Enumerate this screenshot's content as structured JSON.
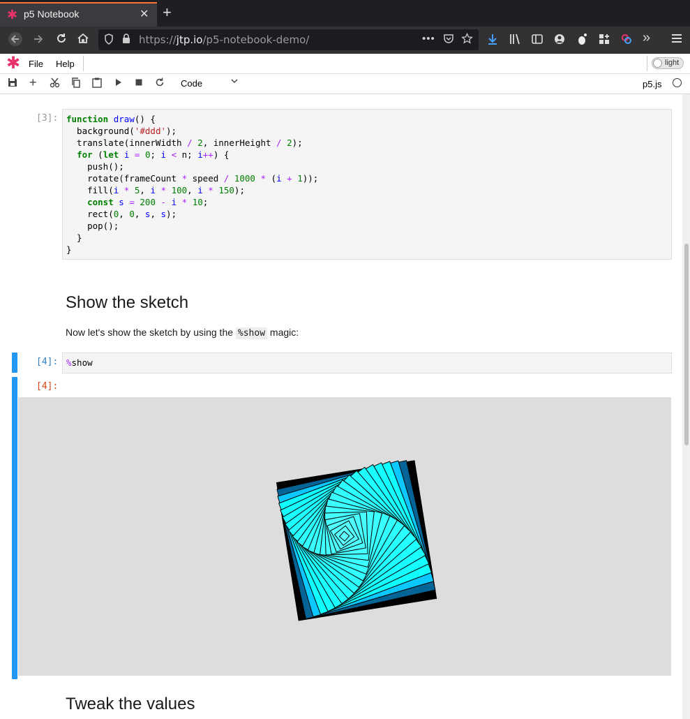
{
  "browser": {
    "tab_title": "p5 Notebook",
    "tab_close": "✕",
    "new_tab": "+",
    "url_host": "jtp.io",
    "url_prefix": "https://",
    "url_path": "/p5-notebook-demo/",
    "url_more": "•••"
  },
  "menu": {
    "items": [
      "File",
      "Help"
    ],
    "theme_label": "light"
  },
  "toolbar": {
    "cell_type": "Code",
    "kernel_name": "p5.js"
  },
  "cells": {
    "code3": {
      "prompt": "[3]:"
    },
    "heading_show": "Show the sketch",
    "para_show_before": "Now let's show the sketch by using the ",
    "para_show_code": "%show",
    "para_show_after": " magic:",
    "code4": {
      "prompt": "[4]:",
      "magic": "%",
      "command": "show"
    },
    "out4": {
      "prompt": "[4]:"
    },
    "heading_tweak": "Tweak the values"
  },
  "colors": {
    "accent_blue": "#2196f3",
    "brand_pink": "#e8326a",
    "sketch_bg": "#dddddd"
  },
  "sketch": {
    "count": 20,
    "base_size": 200,
    "size_step": 10,
    "rotation_step_deg": 3.1
  }
}
